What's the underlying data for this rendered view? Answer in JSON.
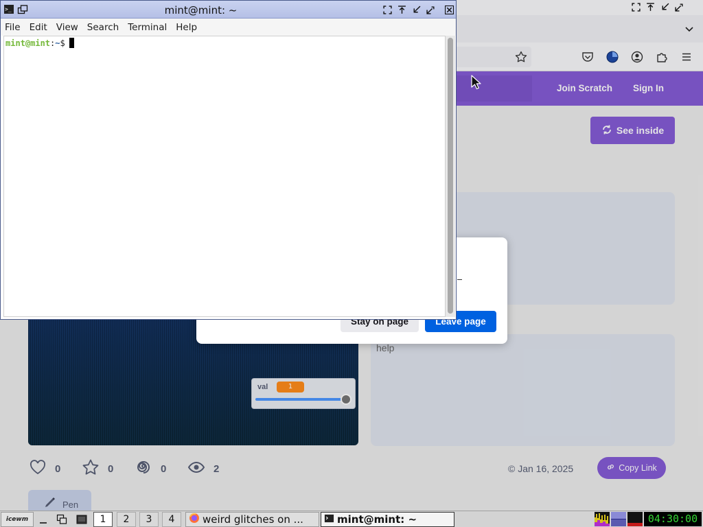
{
  "terminal": {
    "title": "mint@mint: ~",
    "menu": [
      "File",
      "Edit",
      "View",
      "Search",
      "Terminal",
      "Help"
    ],
    "prompt": {
      "user_host": "mint@mint",
      "sep": ":",
      "path": "~",
      "symbol": "$"
    }
  },
  "browser": {
    "page": {
      "nav": {
        "join": "Join Scratch",
        "signin": "Sign In"
      },
      "see_inside": "See inside",
      "notes_text": "help",
      "slider": {
        "label": "val",
        "value": "1",
        "level": 1.0
      },
      "stats": {
        "loves": "0",
        "favorites": "0",
        "remixes": "0",
        "views": "2"
      },
      "date": "© Jan 16, 2025",
      "copy_link": "Copy Link",
      "remix_chip": "Pen"
    },
    "dialog": {
      "stay": "Stay on page",
      "leave": "Leave page"
    }
  },
  "taskbar": {
    "start_label": "icewm",
    "workspaces": [
      "1",
      "2",
      "3",
      "4"
    ],
    "tasks": [
      {
        "label": "weird glitches on ...",
        "icon": "firefox-icon"
      },
      {
        "label": "mint@mint: ~",
        "icon": "terminal-icon"
      }
    ],
    "clock": "04:30:00"
  },
  "colors": {
    "scratch_purple": "#855cd6",
    "firefox_blue": "#0061e0",
    "terminal_prompt_green": "#75b93a",
    "terminal_path_blue": "#3465a4",
    "clock_green": "#36d636"
  }
}
